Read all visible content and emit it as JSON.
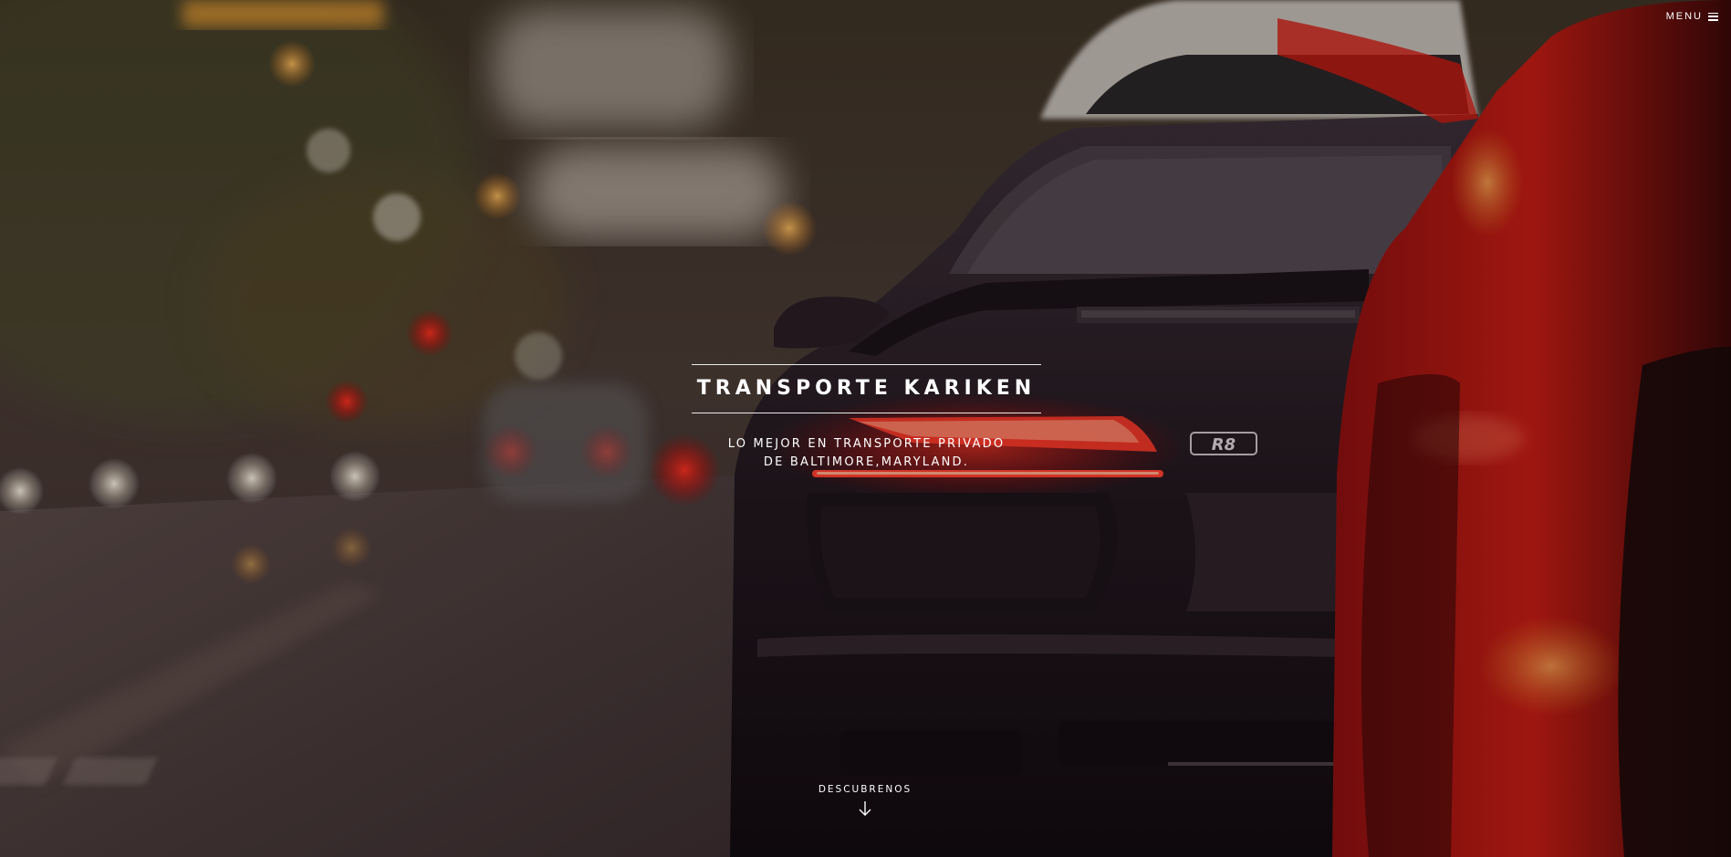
{
  "header": {
    "menu_label": "MENU",
    "menu_icon": "hamburger-icon"
  },
  "hero": {
    "title": "TRANSPORTE KARIKEN",
    "subtitle_line1": "LO MEJOR EN TRANSPORTE PRIVADO",
    "subtitle_line2": "DE BALTIMORE,MARYLAND.",
    "scroll_label": "DESCUBRENOS",
    "scroll_icon": "arrow-down-icon",
    "background_image": "rear view of dark sports car with red tail lights on a blurred city street at dusk",
    "badge_text": "R8"
  },
  "colors": {
    "text": "#ffffff",
    "tail_light": "#e0201a",
    "car_body": "#2a1d24",
    "street": "#4a3d3e"
  }
}
